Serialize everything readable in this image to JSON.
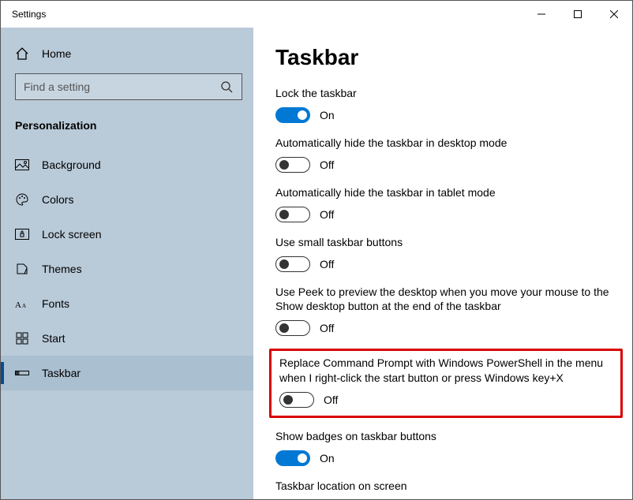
{
  "window": {
    "title": "Settings"
  },
  "sidebar": {
    "home": "Home",
    "search_placeholder": "Find a setting",
    "section": "Personalization",
    "items": [
      {
        "label": "Background"
      },
      {
        "label": "Colors"
      },
      {
        "label": "Lock screen"
      },
      {
        "label": "Themes"
      },
      {
        "label": "Fonts"
      },
      {
        "label": "Start"
      },
      {
        "label": "Taskbar"
      }
    ]
  },
  "main": {
    "heading": "Taskbar",
    "settings": [
      {
        "label": "Lock the taskbar",
        "state": "On"
      },
      {
        "label": "Automatically hide the taskbar in desktop mode",
        "state": "Off"
      },
      {
        "label": "Automatically hide the taskbar in tablet mode",
        "state": "Off"
      },
      {
        "label": "Use small taskbar buttons",
        "state": "Off"
      },
      {
        "label": "Use Peek to preview the desktop when you move your mouse to the Show desktop button at the end of the taskbar",
        "state": "Off"
      },
      {
        "label": "Replace Command Prompt with Windows PowerShell in the menu when I right-click the start button or press Windows key+X",
        "state": "Off"
      },
      {
        "label": "Show badges on taskbar buttons",
        "state": "On"
      },
      {
        "label": "Taskbar location on screen",
        "state": ""
      }
    ]
  }
}
